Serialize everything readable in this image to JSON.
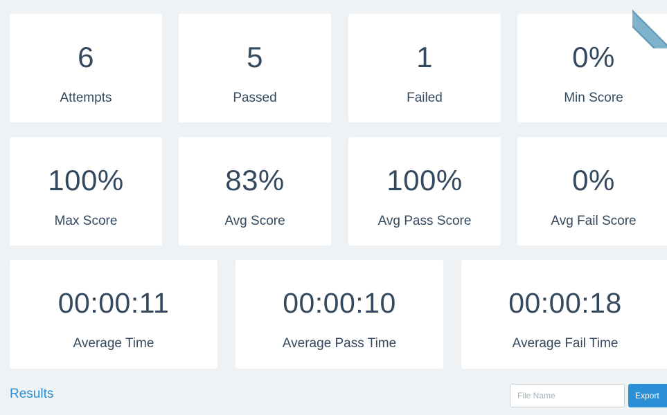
{
  "stats_row1": [
    {
      "value": "6",
      "label": "Attempts"
    },
    {
      "value": "5",
      "label": "Passed"
    },
    {
      "value": "1",
      "label": "Failed"
    },
    {
      "value": "0%",
      "label": "Min Score"
    }
  ],
  "stats_row2": [
    {
      "value": "100%",
      "label": "Max Score"
    },
    {
      "value": "83%",
      "label": "Avg Score"
    },
    {
      "value": "100%",
      "label": "Avg Pass Score"
    },
    {
      "value": "0%",
      "label": "Avg Fail Score"
    }
  ],
  "stats_row3": [
    {
      "value": "00:00:11",
      "label": "Average Time"
    },
    {
      "value": "00:00:10",
      "label": "Average Pass Time"
    },
    {
      "value": "00:00:18",
      "label": "Average Fail Time"
    }
  ],
  "results": {
    "title": "Results",
    "file_name_placeholder": "File Name",
    "file_name_value": "",
    "export_label": "Export"
  },
  "colors": {
    "accent": "#2b8fd6",
    "text": "#34495e",
    "background": "#eef2f4",
    "card": "#ffffff"
  }
}
